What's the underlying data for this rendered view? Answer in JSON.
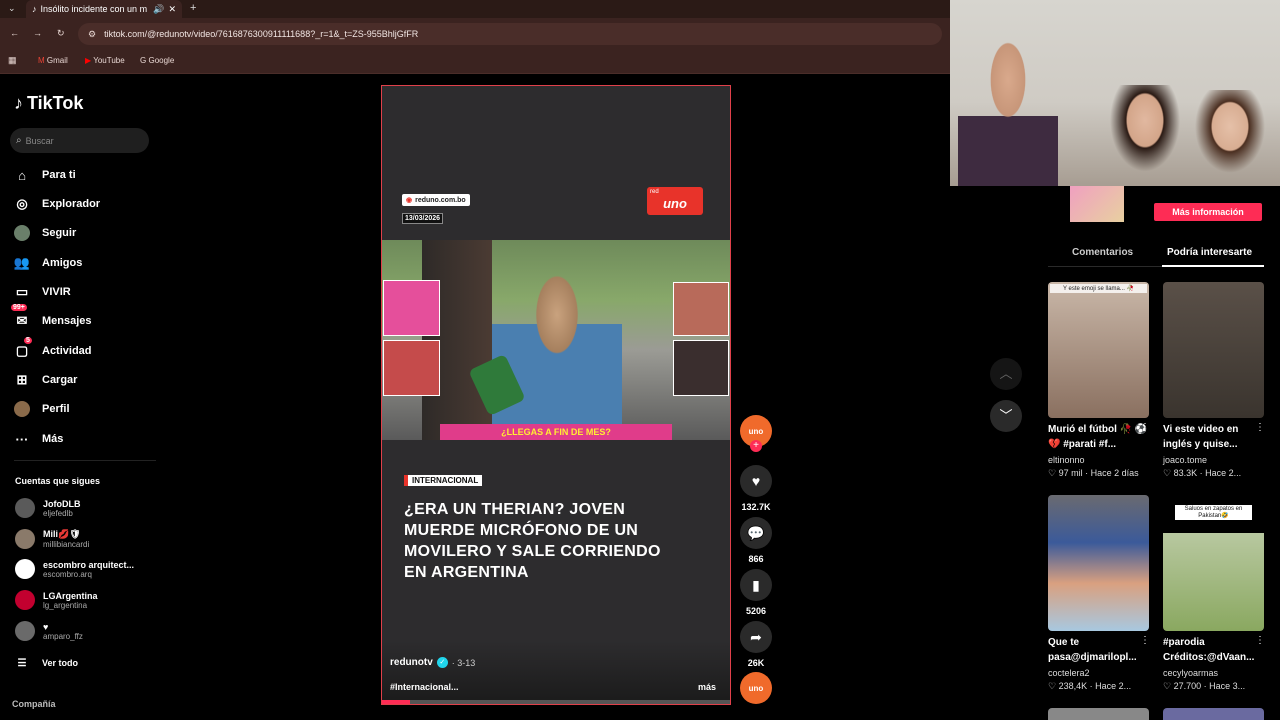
{
  "browser": {
    "tab_title": "Insólito incidente con un m",
    "new_tab": "+",
    "url": "tiktok.com/@redunotv/video/7616876300911111688?_r=1&_t=ZS-955BhljGfFR",
    "bookmarks": [
      "Gmail",
      "YouTube",
      "Google"
    ]
  },
  "sidebar": {
    "logo": "TikTok",
    "search_placeholder": "Buscar",
    "nav": [
      {
        "label": "Para ti",
        "icon": "home-icon"
      },
      {
        "label": "Explorador",
        "icon": "compass-icon"
      },
      {
        "label": "Seguir",
        "icon": "avatar"
      },
      {
        "label": "Amigos",
        "icon": "friends-icon"
      },
      {
        "label": "VIVIR",
        "icon": "live-icon"
      },
      {
        "label": "Mensajes",
        "icon": "message-icon",
        "badge": "99+"
      },
      {
        "label": "Actividad",
        "icon": "activity-icon",
        "badge": "5"
      },
      {
        "label": "Cargar",
        "icon": "upload-icon"
      },
      {
        "label": "Perfil",
        "icon": "avatar"
      },
      {
        "label": "Más",
        "icon": "more-icon"
      }
    ],
    "following_title": "Cuentas que sigues",
    "following": [
      {
        "name": "JofoDLB",
        "handle": "eljefedlb"
      },
      {
        "name": "Mili💋🛡",
        "handle": "millibiancardi"
      },
      {
        "name": "escombro arquitect...",
        "handle": "escombro.arq"
      },
      {
        "name": "LGArgentina",
        "handle": "lg_argentina"
      },
      {
        "name": "♥",
        "handle": "amparo_ffz"
      }
    ],
    "see_all": "Ver todo",
    "company": "Compañía"
  },
  "video": {
    "source": "reduno.com.bo",
    "date": "13/03/2026",
    "logo_small": "red",
    "logo_big": "uno",
    "banner": "¿LLEGAS A FIN DE MES?",
    "category": "INTERNACIONAL",
    "headline": "¿ERA UN THERIAN? JOVEN MUERDE MICRÓFONO DE UN MOVILERO Y SALE CORRIENDO EN ARGENTINA",
    "author": "redunotv",
    "author_date": "· 3-13",
    "hashtag": "#Internacional...",
    "more": "más"
  },
  "actions": {
    "likes": "132.7K",
    "comments": "866",
    "saves": "5206",
    "shares": "26K"
  },
  "right": {
    "more_info": "Más información",
    "tabs": [
      "Comentarios",
      "Podría interesarte"
    ],
    "suggestions": [
      {
        "caption": "Murió el fútbol 🥀 ⚽ 💔 #parati #f...",
        "author": "eltinonno",
        "likes": "97 mil",
        "time": "Hace 2 días",
        "overlay": "Y este emoji se llama... 🥀"
      },
      {
        "caption": "Vi este video en inglés y quise...",
        "author": "joaco.tome",
        "likes": "83.3K",
        "time": "Hace 2...",
        "overlay": ""
      },
      {
        "caption": "Que te pasa@djmarilopl...",
        "author": "coctelera2",
        "likes": "238,4K",
        "time": "Hace 2...",
        "overlay": ""
      },
      {
        "caption": "#parodia Créditos:@dVaan...",
        "author": "cecylyoarmas",
        "likes": "27.700",
        "time": "Hace 3...",
        "overlay": "Saluos en zapatos en Pakistan🤣"
      }
    ]
  },
  "colors": {
    "accent": "#fe2c55",
    "red_uno": "#e8332a",
    "video_border": "#e0404a"
  }
}
